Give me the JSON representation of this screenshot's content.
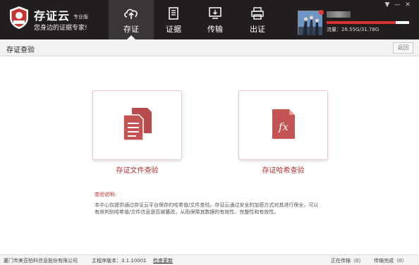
{
  "header": {
    "brand_name": "存证云",
    "brand_edition": "专业版",
    "brand_slogan": "您身边的证据专家!",
    "logo_text": "存证云",
    "nav": [
      {
        "label": "存证",
        "icon": "cloud-upload-icon",
        "active": true
      },
      {
        "label": "证据",
        "icon": "document-icon",
        "active": false
      },
      {
        "label": "传输",
        "icon": "transfer-icon",
        "active": false
      },
      {
        "label": "出证",
        "icon": "printer-icon",
        "active": false
      }
    ],
    "storage_label": "流量：26.55G/31.78G",
    "storage_used": 26.55,
    "storage_total": 31.78,
    "window_controls": [
      "▼",
      "—",
      "✕"
    ]
  },
  "titlebar": {
    "title": "存证查验",
    "back_label": "返回"
  },
  "cards": [
    {
      "label": "存证文件查验",
      "icon": "files-icon"
    },
    {
      "label": "存证哈希查验",
      "icon": "fx-file-icon",
      "icon_text": "fx"
    }
  ],
  "description": {
    "title": "查验说明:",
    "text": "本中心仅提供通过存证云平台保存的哈希值/文件查验。存证云通过安全的加密方式对其进行保全，可以有效判别哈希值/文件信息是否被篡改，从而保障其数据的有效性、完整性和有效性。"
  },
  "statusbar": {
    "company": "厦门市美亚柏科信息股份有限公司",
    "version": "主程序版本：3.1.10001",
    "check_update": "检查更新",
    "uploading": "正在传输（0）",
    "completed": "传输完成（0）"
  },
  "colors": {
    "header_bg": "#221e1f",
    "accent": "#b83a3a",
    "card_icon": "#b84b4b"
  }
}
